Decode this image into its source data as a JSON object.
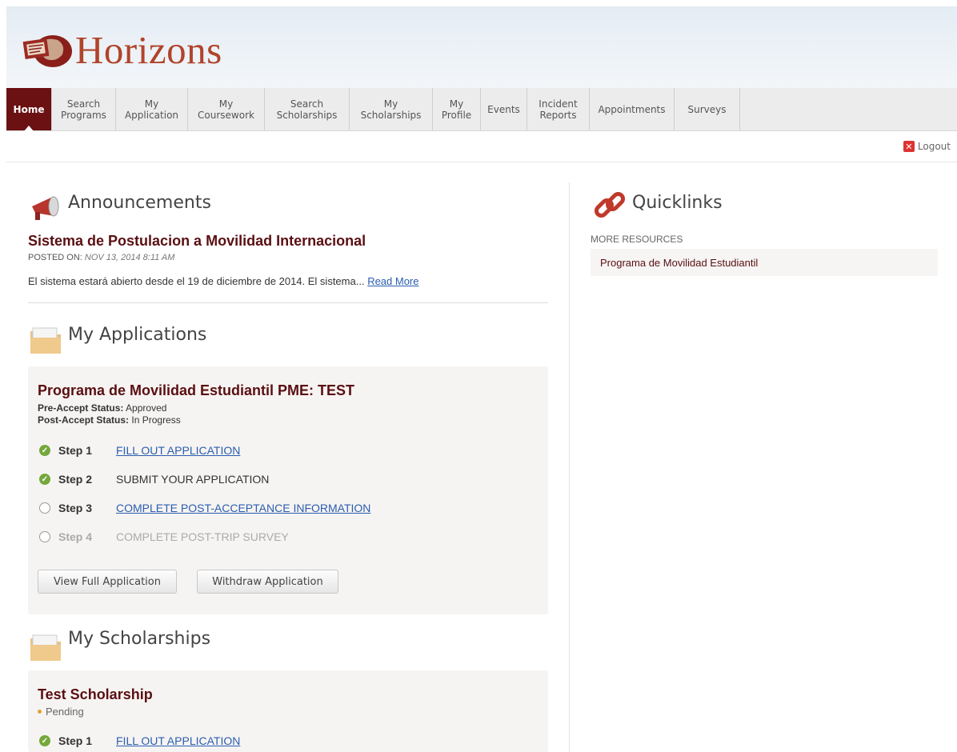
{
  "brand": {
    "name": "Horizons",
    "logo_icon": "globe-map-icon",
    "brand_color": "#b0442a",
    "accent": "#6b1113"
  },
  "nav": [
    {
      "label": "Home",
      "active": true
    },
    {
      "label": "Search\nPrograms"
    },
    {
      "label": "My\nApplication"
    },
    {
      "label": "My\nCoursework"
    },
    {
      "label": "Search\nScholarships"
    },
    {
      "label": "My\nScholarships"
    },
    {
      "label": "My\nProfile"
    },
    {
      "label": "Events"
    },
    {
      "label": "Incident\nReports"
    },
    {
      "label": "Appointments"
    },
    {
      "label": "Surveys"
    }
  ],
  "logout": {
    "label": "Logout",
    "icon": "close-icon"
  },
  "announcements": {
    "title": "Announcements",
    "icon": "megaphone-icon",
    "item": {
      "heading": "Sistema de Postulacion a Movilidad Internacional",
      "posted_label": "POSTED ON:",
      "posted_date": "NOV 13, 2014 8:11 AM",
      "body": "El sistema estará abierto desde el 19 de diciembre de 2014. El sistema...",
      "read_more": "Read More"
    }
  },
  "applications": {
    "title": "My Applications",
    "icon": "folder-icon",
    "card": {
      "program": "Programa de Movilidad Estudiantil PME: TEST",
      "pre_label": "Pre-Accept Status:",
      "pre_value": "Approved",
      "post_label": "Post-Accept Status:",
      "post_value": "In Progress",
      "steps": [
        {
          "num": "Step 1",
          "label": "FILL OUT APPLICATION",
          "state": "done",
          "link": true
        },
        {
          "num": "Step 2",
          "label": "SUBMIT YOUR APPLICATION",
          "state": "done",
          "link": false
        },
        {
          "num": "Step 3",
          "label": "COMPLETE POST-ACCEPTANCE INFORMATION",
          "state": "open",
          "link": true
        },
        {
          "num": "Step 4",
          "label": "COMPLETE POST-TRIP SURVEY",
          "state": "open",
          "link": false,
          "dim": true
        }
      ],
      "view_button": "View Full Application",
      "withdraw_button": "Withdraw Application"
    }
  },
  "scholarships": {
    "title": "My Scholarships",
    "icon": "folder-icon",
    "card": {
      "name": "Test Scholarship",
      "status": "Pending",
      "step1_num": "Step 1",
      "step1_label": "FILL OUT APPLICATION"
    }
  },
  "quicklinks": {
    "title": "Quicklinks",
    "icon": "chain-link-icon",
    "section_label": "MORE RESOURCES",
    "item": "Programa de Movilidad Estudiantil"
  }
}
